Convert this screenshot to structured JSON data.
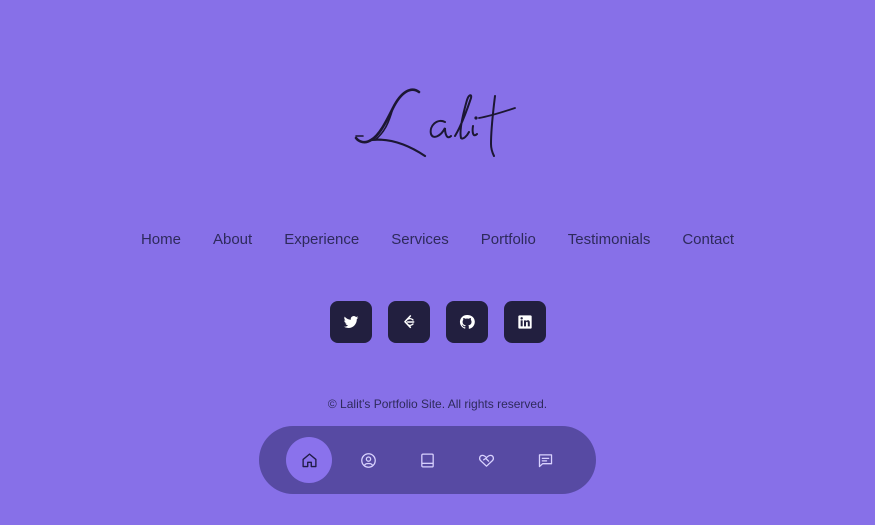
{
  "logo": {
    "text": "Lalit"
  },
  "nav": {
    "items": [
      {
        "label": "Home"
      },
      {
        "label": "About"
      },
      {
        "label": "Experience"
      },
      {
        "label": "Services"
      },
      {
        "label": "Portfolio"
      },
      {
        "label": "Testimonials"
      },
      {
        "label": "Contact"
      }
    ]
  },
  "socials": [
    {
      "icon": "twitter-icon"
    },
    {
      "icon": "leetcode-icon"
    },
    {
      "icon": "github-icon"
    },
    {
      "icon": "linkedin-icon"
    }
  ],
  "footer": {
    "copyright": "© Lalit's Portfolio Site. All rights reserved."
  },
  "dock": {
    "items": [
      {
        "icon": "home-icon",
        "active": true
      },
      {
        "icon": "user-icon",
        "active": false
      },
      {
        "icon": "book-icon",
        "active": false
      },
      {
        "icon": "handshake-icon",
        "active": false
      },
      {
        "icon": "message-icon",
        "active": false
      }
    ]
  },
  "colors": {
    "background": "#8770e8",
    "social_button": "#221f3f",
    "dock": "#574aa3",
    "dock_active": "#8a72ec",
    "text": "#2e2a5c"
  }
}
